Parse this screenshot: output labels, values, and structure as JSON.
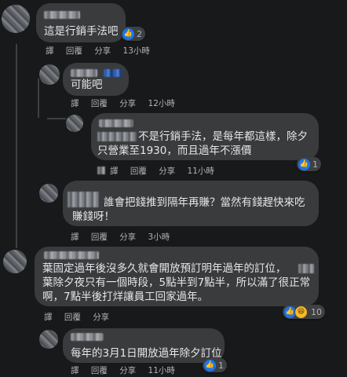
{
  "actions": {
    "translate": "譯",
    "reply": "回覆",
    "share": "分享"
  },
  "comments": [
    {
      "id": "c1",
      "text_lines": [
        "這是行銷手法吧"
      ],
      "time": "13小時",
      "reactions": {
        "count": "2",
        "types": [
          "like"
        ]
      }
    },
    {
      "id": "c2",
      "text_lines": [
        "可能吧"
      ],
      "time": "12小時",
      "reactions": null
    },
    {
      "id": "c3",
      "text_lines": [
        "不是行銷手法，是每年都這樣，除夕",
        "只營業至1930，而且過年不漲價"
      ],
      "time": "11小時",
      "reactions": {
        "count": "1",
        "types": [
          "like"
        ]
      }
    },
    {
      "id": "c4",
      "text_lines": [
        "誰會把錢推到隔年再賺？當然有錢趕快來吃",
        "賺錢呀！"
      ],
      "time": "3小時",
      "reactions": null
    },
    {
      "id": "c5",
      "text_lines": [
        "葉固定過年後沒多久就會開放預訂明年過年的訂位，",
        "葉除夕夜只有一個時段，5點半到7點半，所以滿了很正常",
        "啊，7點半後打烊讓員工回家過年。"
      ],
      "time": "",
      "reactions": {
        "count": "10",
        "types": [
          "like",
          "haha"
        ]
      }
    },
    {
      "id": "c6",
      "text_lines": [
        "每年的3月1日開放過年除夕訂位"
      ],
      "time": "11小時",
      "reactions": {
        "count": "1",
        "types": [
          "like"
        ]
      }
    }
  ],
  "icons": {
    "like": "thumbs-up-icon",
    "haha": "laugh-icon"
  }
}
